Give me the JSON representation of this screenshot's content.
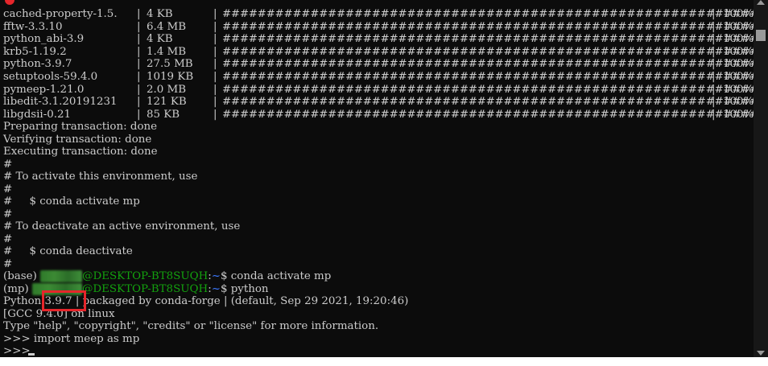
{
  "terminal": {
    "colors": {
      "background": "#0c0c0c",
      "text": "#cccccc",
      "prompt_user": "#13a10e",
      "prompt_path": "#3b78ff",
      "highlight_box": "#e6262b"
    },
    "packages": [
      {
        "name": "cached-property-1.5.",
        "size": "4 KB",
        "progress": "##############################################################",
        "percent": "100%"
      },
      {
        "name": "fftw-3.3.10",
        "size": "6.4 MB",
        "progress": "##############################################################",
        "percent": "100%"
      },
      {
        "name": "python_abi-3.9",
        "size": "4 KB",
        "progress": "##############################################################",
        "percent": "100%"
      },
      {
        "name": "krb5-1.19.2",
        "size": "1.4 MB",
        "progress": "##############################################################",
        "percent": "100%"
      },
      {
        "name": "python-3.9.7",
        "size": "27.5 MB",
        "progress": "##############################################################",
        "percent": "100%"
      },
      {
        "name": "setuptools-59.4.0",
        "size": "1019 KB",
        "progress": "##############################################################",
        "percent": "100%"
      },
      {
        "name": "pymeep-1.21.0",
        "size": "2.0 MB",
        "progress": "##############################################################",
        "percent": "100%"
      },
      {
        "name": "libedit-3.1.20191231",
        "size": "121 KB",
        "progress": "##############################################################",
        "percent": "100%"
      },
      {
        "name": "libgdsii-0.21",
        "size": "85 KB",
        "progress": "##############################################################",
        "percent": "100%"
      }
    ],
    "separator": "|",
    "status_lines": [
      "Preparing transaction: done",
      "Verifying transaction: done",
      "Executing transaction: done"
    ],
    "comment_lines": [
      "#",
      "# To activate this environment, use",
      "#",
      "#     $ conda activate mp",
      "#",
      "# To deactivate an active environment, use",
      "#",
      "#     $ conda deactivate",
      "#"
    ],
    "prompt1": {
      "env": "(base) ",
      "user": "user",
      "host": "@DESKTOP-BT8SUQH",
      "colon": ":",
      "path": "~",
      "symbol": "$ ",
      "command": "conda activate mp"
    },
    "prompt2": {
      "env": "(mp) ",
      "user": "user",
      "host": "@DESKTOP-BT8SUQH",
      "colon": ":",
      "path": "~",
      "symbol": "$ ",
      "command": "python"
    },
    "python_banner": {
      "prefix": "Python ",
      "version": "3.9.7",
      "rest": " | packaged by conda-forge | (default, Sep 29 2021, 19:20:46)",
      "gcc": "[GCC 9.4.0] on linux",
      "help": "Type \"help\", \"copyright\", \"credits\" or \"license\" for more information."
    },
    "repl1": {
      "prompt": ">>> ",
      "command": "import meep as mp"
    },
    "repl2": {
      "prompt": ">>> "
    }
  }
}
